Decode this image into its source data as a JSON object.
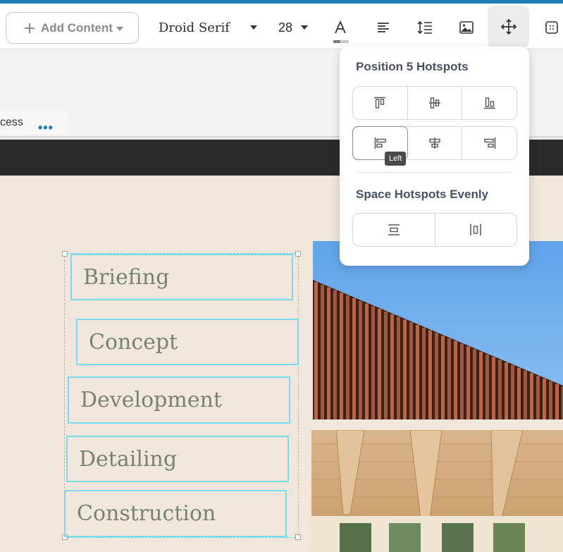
{
  "toolbar": {
    "add_content_label": "Add Content",
    "font_family_value": "Droid Serif",
    "font_size_value": "28",
    "icons": [
      "text-color-icon",
      "align-left-icon",
      "line-height-icon",
      "image-icon",
      "move-icon",
      "grid-icon"
    ]
  },
  "subbar": {
    "tab_label": "cess",
    "more_label": "•••"
  },
  "popover": {
    "position_title": "Position 5 Hotspots",
    "space_title": "Space Hotspots Evenly",
    "tooltip": "Left"
  },
  "hotspots": [
    {
      "label": "Briefing"
    },
    {
      "label": "Concept"
    },
    {
      "label": "Development"
    },
    {
      "label": "Detailing"
    },
    {
      "label": "Construction"
    }
  ],
  "colors": {
    "accent": "#1d7db0",
    "hotspot_border": "#79dbee",
    "canvas_bg": "#f0e6dc",
    "hotspot_text": "#7a826d"
  }
}
